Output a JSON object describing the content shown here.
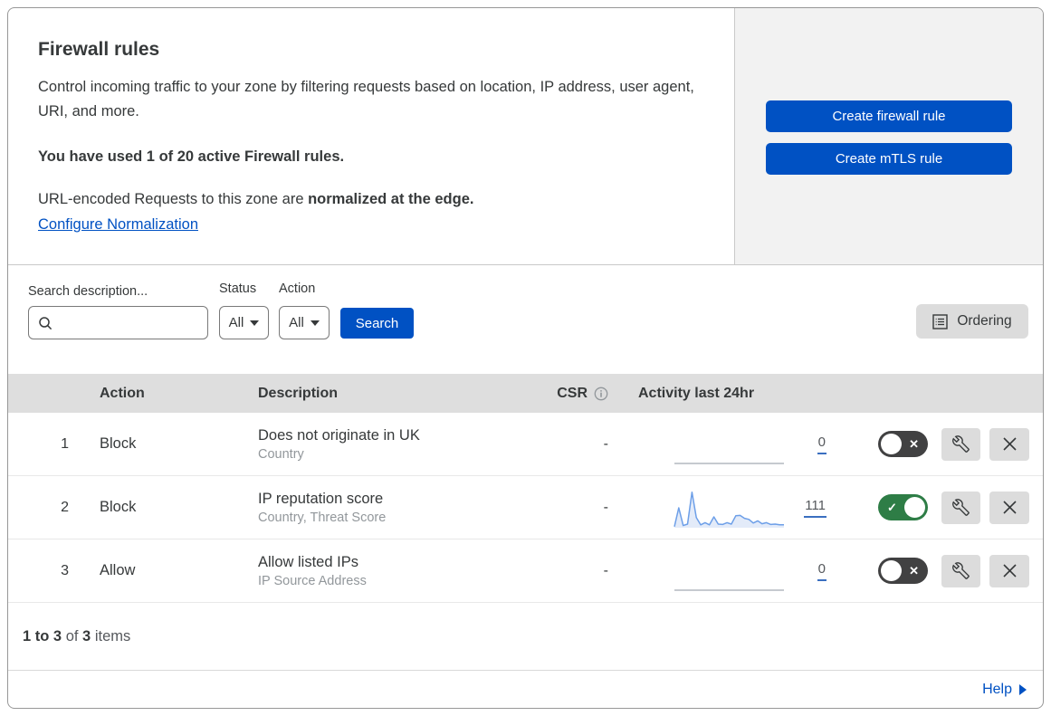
{
  "header": {
    "title": "Firewall rules",
    "description": "Control incoming traffic to your zone by filtering requests based on location, IP address, user agent, URI, and more.",
    "usage": "You have used 1 of 20 active Firewall rules.",
    "normalization_text": "URL-encoded Requests to this zone are ",
    "normalization_bold": "normalized at the edge.",
    "normalization_link": "Configure Normalization"
  },
  "panel": {
    "create_firewall_label": "Create firewall rule",
    "create_mtls_label": "Create mTLS rule"
  },
  "filters": {
    "search_label": "Search description...",
    "status_label": "Status",
    "status_value": "All",
    "action_label": "Action",
    "action_value": "All",
    "search_button": "Search",
    "ordering_button": "Ordering"
  },
  "table": {
    "headers": {
      "action": "Action",
      "description": "Description",
      "csr": "CSR",
      "activity": "Activity last 24hr"
    },
    "rows": [
      {
        "priority": "1",
        "action": "Block",
        "description": "Does not originate in UK",
        "criteria": "Country",
        "csr": "-",
        "activity_count": "0",
        "enabled": false,
        "sparkline": []
      },
      {
        "priority": "2",
        "action": "Block",
        "description": "IP reputation score",
        "criteria": "Country, Threat Score",
        "csr": "-",
        "activity_count": "111",
        "enabled": true,
        "sparkline": [
          3,
          55,
          6,
          10,
          98,
          28,
          8,
          14,
          8,
          30,
          10,
          9,
          14,
          10,
          33,
          34,
          26,
          23,
          13,
          19,
          11,
          14,
          9,
          10,
          8,
          8
        ]
      },
      {
        "priority": "3",
        "action": "Allow",
        "description": "Allow listed IPs",
        "criteria": "IP Source Address",
        "csr": "-",
        "activity_count": "0",
        "enabled": false,
        "sparkline": []
      }
    ]
  },
  "footer": {
    "range": "1 to 3",
    "of": " of ",
    "total": "3",
    "items": " items",
    "help": "Help"
  },
  "glyphs": {
    "toggle_on": "✓",
    "toggle_off": "✕"
  },
  "colors": {
    "accent_blue": "#0051c3",
    "toggle_on_green": "#2e7d46",
    "toggle_off_gray": "#414142",
    "sparkline_blue": "#6d9fe8",
    "header_band": "#dedede",
    "panel_gray": "#f2f2f2"
  }
}
